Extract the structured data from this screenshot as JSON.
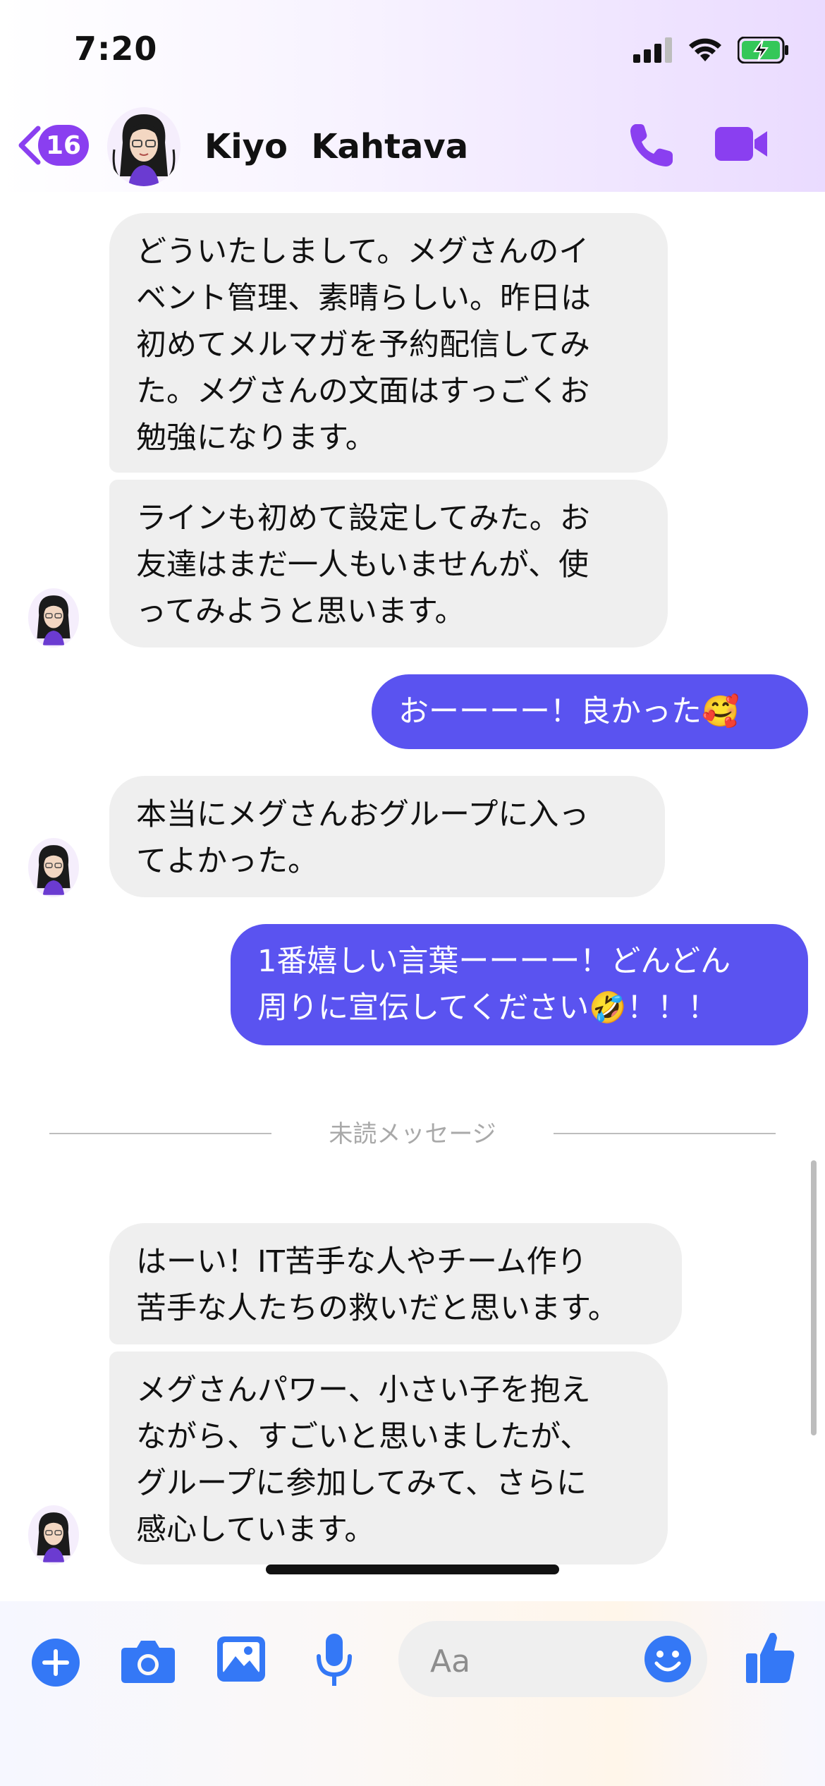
{
  "status_bar": {
    "time": "7:20",
    "icons": [
      "signal-icon",
      "wifi-icon",
      "battery-charging-icon"
    ]
  },
  "header": {
    "back_badge": "16",
    "contact_name": "Kiyo  Kahtava",
    "accent": "#8a3ff0",
    "icons": [
      "back-chevron-icon",
      "phone-icon",
      "video-camera-icon"
    ]
  },
  "messages": [
    {
      "from": "them",
      "text": "どういたしまして。メグさんのイ\nベント管理、素晴らしい。昨日は\n初めてメルマガを予約配信してみ\nた。メグさんの文面はすっごくお\n勉強になります。"
    },
    {
      "from": "them",
      "text": "ラインも初めて設定してみた。お\n友達はまだ一人もいませんが、使\nってみようと思います。"
    },
    {
      "from": "me",
      "text": "おーーーー！良かった🥰"
    },
    {
      "from": "them",
      "text": "本当にメグさんおグループに入っ\nてよかった。"
    },
    {
      "from": "me",
      "text": "1番嬉しい言葉ーーーー！どんどん\n周りに宣伝してください🤣！！！"
    },
    {
      "from": "them",
      "text": "はーい！IT苦手な人やチーム作り\n苦手な人たちの救いだと思います。"
    },
    {
      "from": "them",
      "text": "メグさんパワー、小さい子を抱え\nながら、すごいと思いましたが、\nグループに参加してみて、さらに\n感心しています。"
    }
  ],
  "unread_divider": "未読メッセージ",
  "composer": {
    "placeholder": "Aa",
    "icons": [
      "plus-icon",
      "camera-icon",
      "image-icon",
      "microphone-icon",
      "emoji-icon",
      "thumbs-up-icon"
    ],
    "icon_color": "#3478f6"
  },
  "colors": {
    "outgoing_bubble": "#5a53f0",
    "incoming_bubble": "#efefef"
  }
}
